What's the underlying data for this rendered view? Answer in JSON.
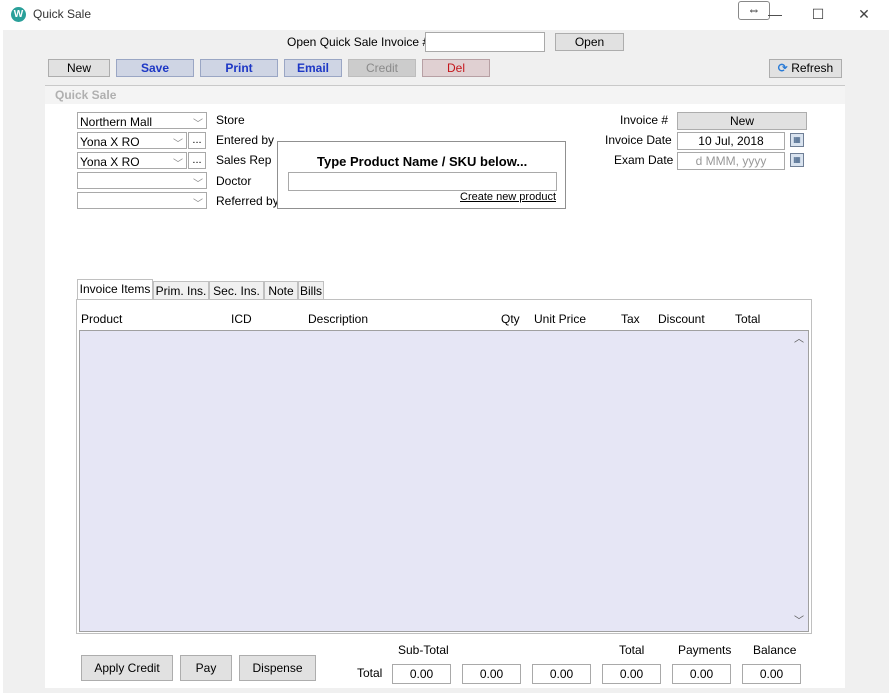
{
  "window": {
    "title": "Quick Sale",
    "app_icon_letter": "W",
    "expand_symbol": "⇔",
    "minimize": "—",
    "maximize": "☐",
    "close": "✕"
  },
  "open_invoice": {
    "label": "Open Quick Sale Invoice #",
    "value": "",
    "button": "Open"
  },
  "toolbar": {
    "new": "New",
    "save": "Save",
    "print": "Print",
    "email": "Email",
    "credit": "Credit",
    "del": "Del",
    "refresh": "Refresh",
    "refresh_icon": "refresh-icon"
  },
  "section_title": "Quick Sale",
  "form": {
    "store_value": "Northern Mall",
    "store_label": "Store",
    "entered_by_value": "Yona X RO",
    "entered_by_label": "Entered by",
    "sales_rep_value": "Yona X RO",
    "sales_rep_label": "Sales Rep",
    "doctor_value": "",
    "doctor_label": "Doctor",
    "referred_by_value": "",
    "referred_by_label": "Referred by",
    "ellipsis": "..."
  },
  "product_popup": {
    "heading": "Type Product Name / SKU below...",
    "input_value": "",
    "create_link": "Create new product"
  },
  "invoice": {
    "number_label": "Invoice #",
    "number_value": "New",
    "date_label": "Invoice Date",
    "date_value": "10 Jul, 2018",
    "exam_label": "Exam Date",
    "exam_placeholder": "d MMM, yyyy"
  },
  "tabs": [
    "Invoice Items",
    "Prim. Ins.",
    "Sec. Ins.",
    "Note",
    "Bills"
  ],
  "grid": {
    "columns": [
      "Product",
      "ICD",
      "Description",
      "Qty",
      "Unit Price",
      "Tax",
      "Discount",
      "Total"
    ],
    "rows": []
  },
  "footer": {
    "apply_credit": "Apply Credit",
    "pay": "Pay",
    "dispense": "Dispense",
    "total_row_label": "Total",
    "subtotal_header": "Sub-Total",
    "total_header": "Total",
    "payments_header": "Payments",
    "balance_header": "Balance",
    "values": [
      "0.00",
      "0.00",
      "0.00",
      "0.00",
      "0.00",
      "0.00"
    ]
  },
  "colors": {
    "accent_button_text": "#1d37c5",
    "delete_text": "#c4161c",
    "grid_background": "#e6e6f5",
    "app_icon": "#2aa09a"
  }
}
